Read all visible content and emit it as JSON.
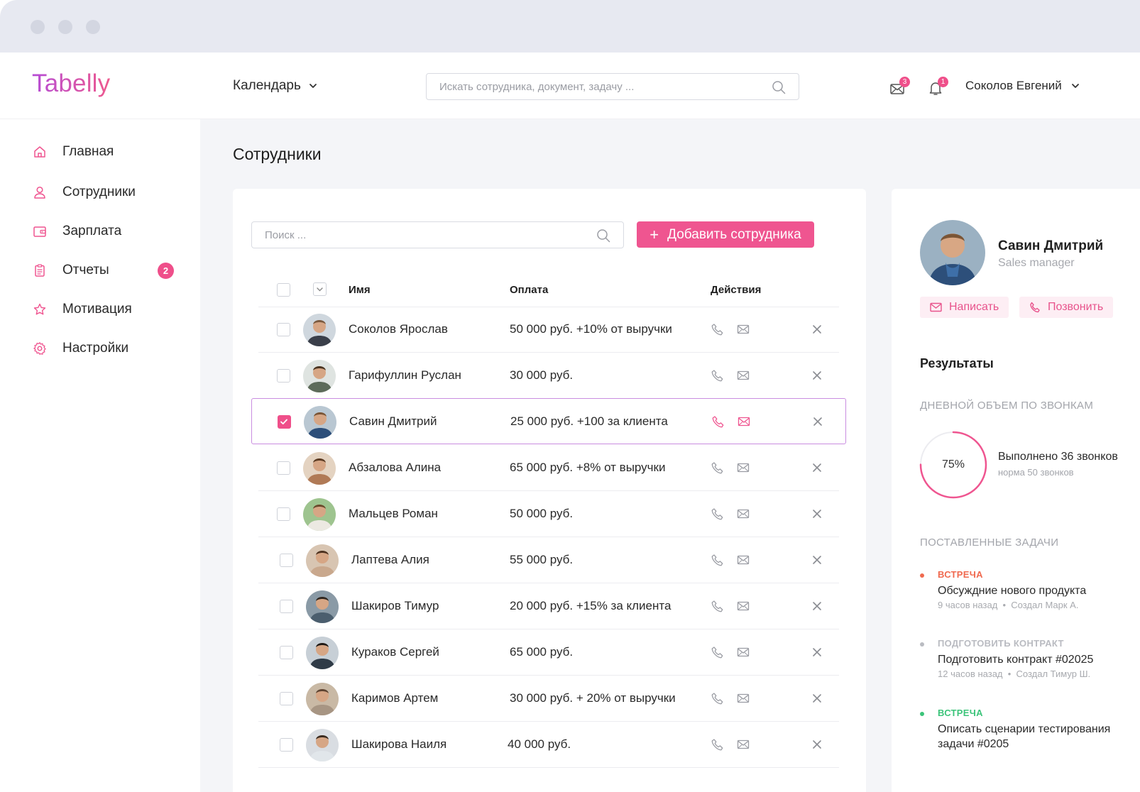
{
  "app": {
    "logo": "Tabelly"
  },
  "header": {
    "calendar_menu": "Календарь",
    "search_placeholder": "Искать сотрудника, документ, задачу ...",
    "mail_count": "3",
    "notif_count": "1",
    "user_name": "Соколов Евгений"
  },
  "sidebar": {
    "items": [
      {
        "label": "Главная",
        "icon": "home-icon"
      },
      {
        "label": "Сотрудники",
        "icon": "user-icon"
      },
      {
        "label": "Зарплата",
        "icon": "wallet-icon"
      },
      {
        "label": "Отчеты",
        "icon": "clipboard-icon",
        "badge": "2"
      },
      {
        "label": "Мотивация",
        "icon": "star-icon"
      },
      {
        "label": "Настройки",
        "icon": "gear-icon"
      }
    ]
  },
  "main": {
    "title": "Сотрудники",
    "search_placeholder": "Поиск ...",
    "add_button": "Добавить сотрудника",
    "columns": {
      "name": "Имя",
      "pay": "Оплата",
      "actions": "Действия"
    },
    "rows": [
      {
        "name": "Соколов Ярослав",
        "pay": "50 000 руб. +10% от выручки",
        "selected": false
      },
      {
        "name": "Гарифуллин Руслан",
        "pay": "30 000 руб.",
        "selected": false
      },
      {
        "name": "Савин Дмитрий",
        "pay": "25 000 руб. +100 за клиента",
        "selected": true
      },
      {
        "name": "Абзалова Алина",
        "pay": "65 000 руб. +8% от выручки",
        "selected": false
      },
      {
        "name": "Мальцев Роман",
        "pay": "50 000 руб.",
        "selected": false
      },
      {
        "name": "Лаптева Алия",
        "pay": "55 000 руб.",
        "selected": false
      },
      {
        "name": "Шакиров Тимур",
        "pay": "20 000 руб. +15% за клиента",
        "selected": false
      },
      {
        "name": "Кураков Сергей",
        "pay": "65 000 руб.",
        "selected": false
      },
      {
        "name": "Каримов Артем",
        "pay": "30 000 руб. + 20% от выручки",
        "selected": false
      },
      {
        "name": "Шакирова Наиля",
        "pay": "40 000 руб.",
        "selected": false
      }
    ]
  },
  "profile": {
    "name": "Савин Дмитрий",
    "role": "Sales manager",
    "write_button": "Написать",
    "call_button": "Позвонить",
    "results_title": "Результаты",
    "calls_section": "ДНЕВНОЙ ОБЪЕМ ПО ЗВОНКАМ",
    "calls_percent": "75%",
    "calls_progress": 0.75,
    "calls_done": "Выполнено 36 звонков",
    "calls_norm": "норма  50 звонков",
    "tasks_section": "ПОСТАВЛЕННЫЕ ЗАДАЧИ",
    "tasks": [
      {
        "type": "ВСТРЕЧА",
        "type_color": "#f06a4f",
        "title": "Обсуждние нового продукта",
        "time": "9 часов назад",
        "author": "Создал Марк А."
      },
      {
        "type": "ПОДГОТОВИТЬ КОНТРАКТ",
        "type_color": "#b9bbc1",
        "title": "Подготовить контракт #02025",
        "time": "12 часов назад",
        "author": "Создал Тимур Ш."
      },
      {
        "type": "ВСТРЕЧА",
        "type_color": "#3cc47a",
        "title": "Описать сценарии тестирования задачи #0205",
        "time": "",
        "author": ""
      }
    ]
  },
  "colors": {
    "accent": "#ef5590",
    "brand_gradient_start": "#b54cd6",
    "brand_gradient_end": "#ee5a8f"
  }
}
